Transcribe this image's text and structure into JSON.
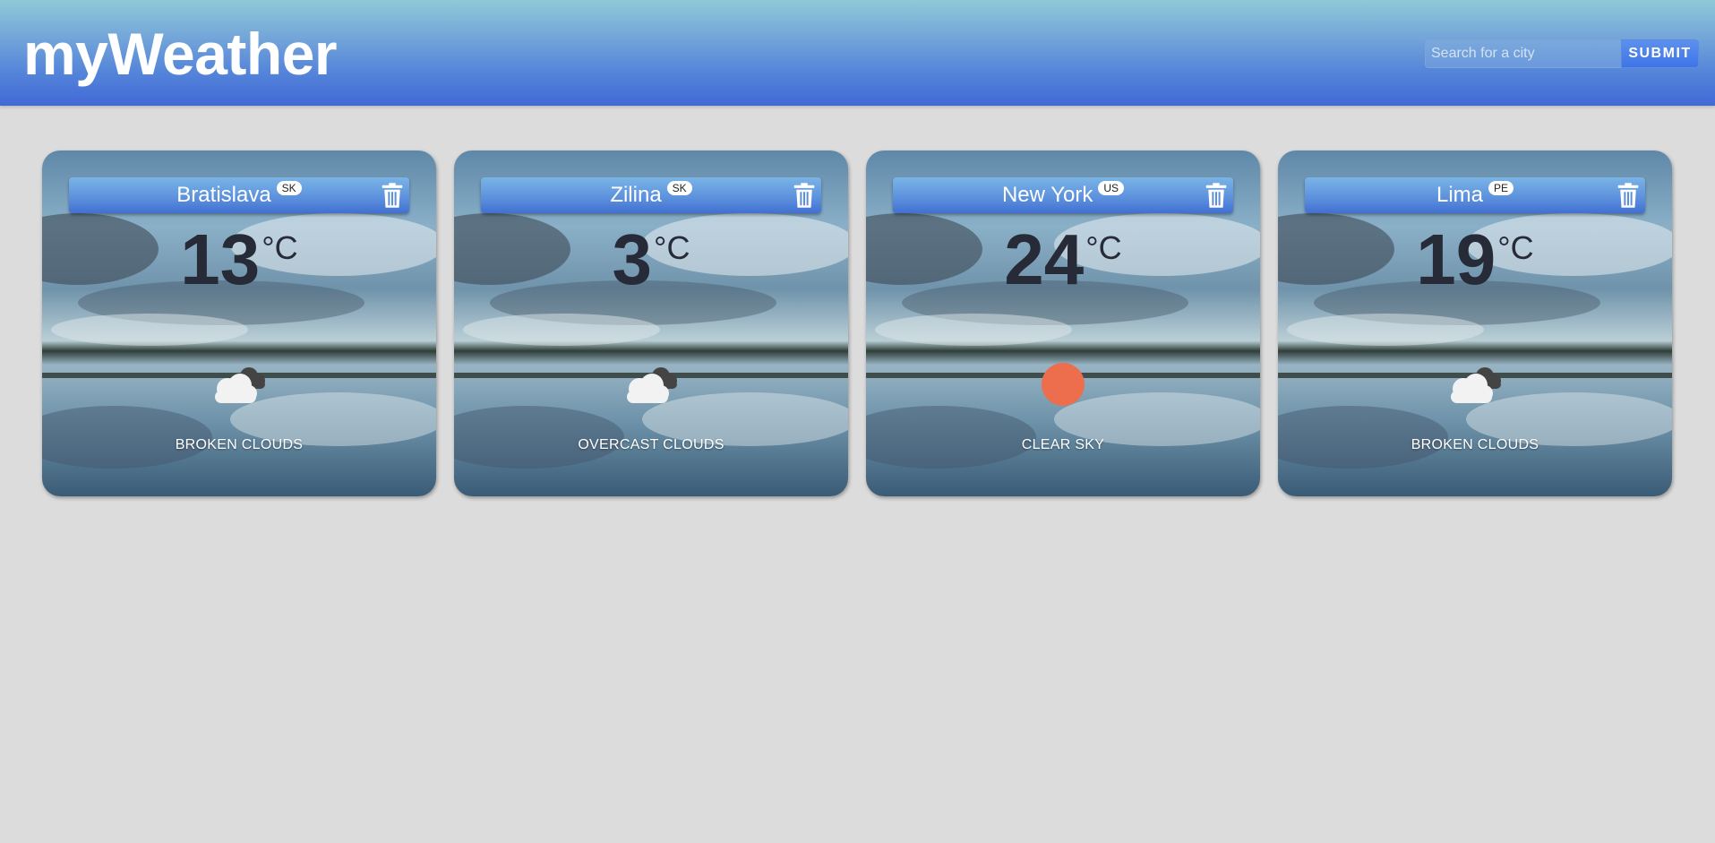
{
  "app": {
    "title": "myWeather"
  },
  "search": {
    "placeholder": "Search for a city",
    "submit_label": "SUBMIT"
  },
  "colors": {
    "header_top": "#8fc9d6",
    "header_bottom": "#4169d6",
    "page_background": "#dcdcdc",
    "temperature_text": "#272b38",
    "sun": "#ec6e4c"
  },
  "cards": [
    {
      "city": "Bratislava",
      "country": "SK",
      "temp": "13",
      "unit": "°C",
      "condition": "BROKEN CLOUDS",
      "icon": "broken-clouds-icon"
    },
    {
      "city": "Zilina",
      "country": "SK",
      "temp": "3",
      "unit": "°C",
      "condition": "OVERCAST CLOUDS",
      "icon": "overcast-clouds-icon"
    },
    {
      "city": "New York",
      "country": "US",
      "temp": "24",
      "unit": "°C",
      "condition": "CLEAR SKY",
      "icon": "sun-icon"
    },
    {
      "city": "Lima",
      "country": "PE",
      "temp": "19",
      "unit": "°C",
      "condition": "BROKEN CLOUDS",
      "icon": "broken-clouds-icon"
    }
  ]
}
